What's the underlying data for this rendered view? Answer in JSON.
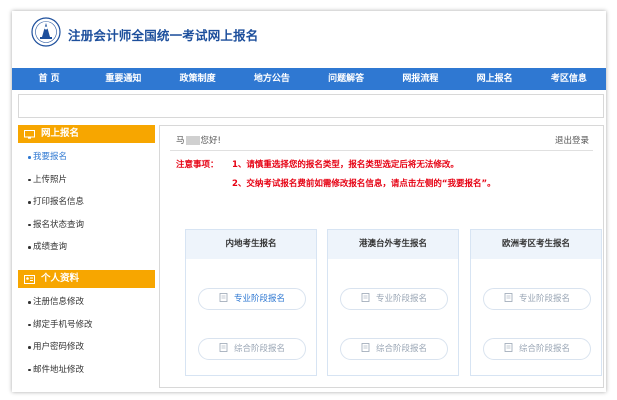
{
  "header": {
    "site_title": "注册会计师全国统一考试网上报名"
  },
  "nav": {
    "items": [
      {
        "label": "首 页"
      },
      {
        "label": "重要通知"
      },
      {
        "label": "政策制度"
      },
      {
        "label": "地方公告"
      },
      {
        "label": "问题解答"
      },
      {
        "label": "网报流程"
      },
      {
        "label": "网上报名"
      },
      {
        "label": "考区信息"
      }
    ]
  },
  "sidebar": {
    "section1": {
      "title": "网上报名",
      "items": [
        {
          "label": "我要报名"
        },
        {
          "label": "上传照片"
        },
        {
          "label": "打印报名信息"
        },
        {
          "label": "报名状态查询"
        },
        {
          "label": "成绩查询"
        }
      ]
    },
    "section2": {
      "title": "个人资料",
      "items": [
        {
          "label": "注册信息修改"
        },
        {
          "label": "绑定手机号修改"
        },
        {
          "label": "用户密码修改"
        },
        {
          "label": "邮件地址修改"
        }
      ]
    }
  },
  "main": {
    "welcome_prefix": "马",
    "welcome_suffix": "您好!",
    "logout_label": "退出登录",
    "notice_label": "注意事项：",
    "notices": [
      "1、请慎重选择您的报名类型，报名类型选定后将无法修改。",
      "2、交纳考试报名费前如需修改报名信息，请点击左侧的“我要报名”。"
    ],
    "cards": [
      {
        "title": "内地考生报名",
        "buttons": [
          {
            "label": "专业阶段报名"
          },
          {
            "label": "综合阶段报名"
          }
        ]
      },
      {
        "title": "港澳台外考生报名",
        "buttons": [
          {
            "label": "专业阶段报名"
          },
          {
            "label": "综合阶段报名"
          }
        ]
      },
      {
        "title": "欧洲考区考生报名",
        "buttons": [
          {
            "label": "专业阶段报名"
          },
          {
            "label": "综合阶段报名"
          }
        ]
      }
    ]
  },
  "colors": {
    "nav_bg": "#2f78d2",
    "title": "#1d4f9c",
    "sidebar_header": "#f7a600",
    "notice_red": "#e60012",
    "active_link": "#2f78d2"
  }
}
